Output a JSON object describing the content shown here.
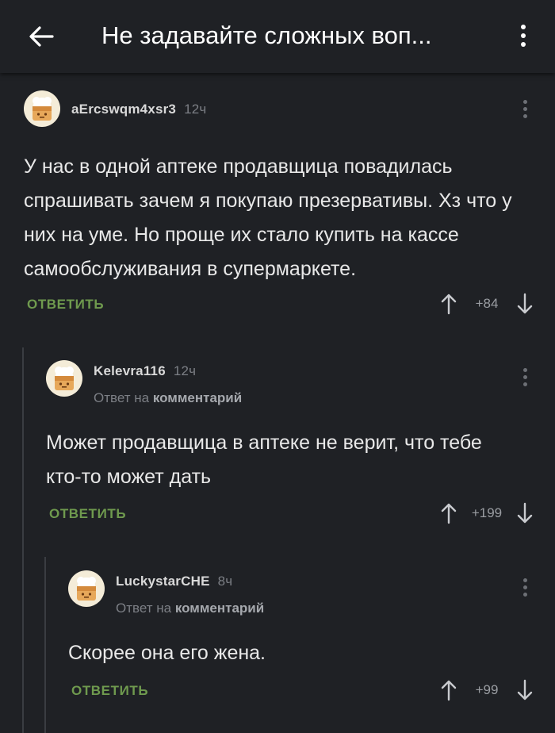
{
  "header": {
    "title": "Не задавайте сложных воп..."
  },
  "comments": [
    {
      "username": "aErcswqm4xsr3",
      "time": "12ч",
      "text": "У нас в одной аптеке продавщица повадилась спрашивать зачем я покупаю презервативы. Хз что у них на уме. Но проще их стало купить на кассе самообслуживания в супермаркете.",
      "reply_label": "ОТВЕТИТЬ",
      "score": "+84"
    },
    {
      "username": "Kelevra116",
      "time": "12ч",
      "reply_to_prefix": "Ответ на",
      "reply_to_link": "комментарий",
      "text": "Может продавщица в аптеке не верит, что тебе кто-то может дать",
      "reply_label": "ОТВЕТИТЬ",
      "score": "+199"
    },
    {
      "username": "LuckystarCHE",
      "time": "8ч",
      "reply_to_prefix": "Ответ на",
      "reply_to_link": "комментарий",
      "text": "Скорее она его жена.",
      "reply_label": "ОТВЕТИТЬ",
      "score": "+99"
    }
  ],
  "colors": {
    "background": "#1f2125",
    "reply_accent": "#6f9a4e",
    "text": "#e8e8e8",
    "muted": "#7c7f85"
  },
  "icons": {
    "back": "arrow-left-icon",
    "menu": "vertical-dots-icon",
    "upvote": "arrow-up-icon",
    "downvote": "arrow-down-icon",
    "avatar": "default-avatar-icon"
  }
}
